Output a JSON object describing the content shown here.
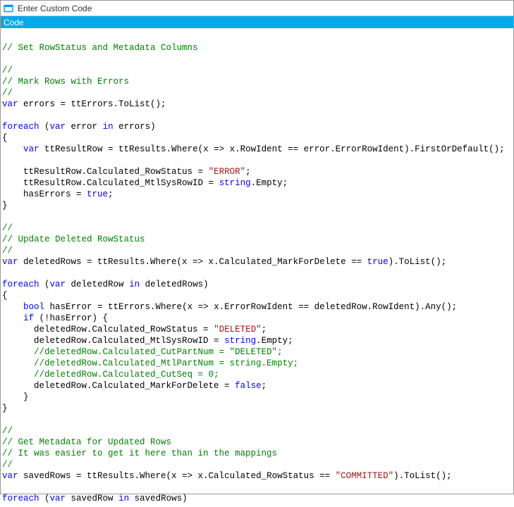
{
  "window": {
    "title": "Enter Custom Code"
  },
  "tab": {
    "label": "Code"
  },
  "code": {
    "l1": "// Set RowStatus and Metadata Columns",
    "l2": "",
    "l3": "//",
    "l4": "// Mark Rows with Errors",
    "l5": "//",
    "l6a": "var",
    "l6b": " errors = ttErrors.ToList();",
    "l7": "",
    "l8a": "foreach",
    "l8b": " (",
    "l8c": "var",
    "l8d": " error ",
    "l8e": "in",
    "l8f": " errors)",
    "l9": "{",
    "l10a": "    ",
    "l10b": "var",
    "l10c": " ttResultRow = ttResults.Where(x => x.RowIdent == error.ErrorRowIdent).FirstOrDefault();",
    "l11": "",
    "l12a": "    ttResultRow.Calculated_RowStatus = ",
    "l12b": "\"ERROR\"",
    "l12c": ";",
    "l13a": "    ttResultRow.Calculated_MtlSysRowID = ",
    "l13b": "string",
    "l13c": ".Empty;",
    "l14a": "    hasErrors = ",
    "l14b": "true",
    "l14c": ";",
    "l15": "}",
    "l16": "",
    "l17": "//",
    "l18": "// Update Deleted RowStatus",
    "l19": "//",
    "l20a": "var",
    "l20b": " deletedRows = ttResults.Where(x => x.Calculated_MarkForDelete == ",
    "l20c": "true",
    "l20d": ").ToList();",
    "l21": "",
    "l22a": "foreach",
    "l22b": " (",
    "l22c": "var",
    "l22d": " deletedRow ",
    "l22e": "in",
    "l22f": " deletedRows)",
    "l23": "{",
    "l24a": "    ",
    "l24b": "bool",
    "l24c": " hasError = ttErrors.Where(x => x.ErrorRowIdent == deletedRow.RowIdent).Any();",
    "l25a": "    ",
    "l25b": "if",
    "l25c": " (!hasError) {",
    "l26a": "      deletedRow.Calculated_RowStatus = ",
    "l26b": "\"DELETED\"",
    "l26c": ";",
    "l27a": "      deletedRow.Calculated_MtlSysRowID = ",
    "l27b": "string",
    "l27c": ".Empty;",
    "l28": "      //deletedRow.Calculated_CutPartNum = \"DELETED\";",
    "l29": "      //deletedRow.Calculated_MtlPartNum = string.Empty;",
    "l30": "      //deletedRow.Calculated_CutSeq = 0;",
    "l31a": "      deletedRow.Calculated_MarkForDelete = ",
    "l31b": "false",
    "l31c": ";",
    "l32": "    }",
    "l33": "}",
    "l34": "",
    "l35": "//",
    "l36": "// Get Metadata for Updated Rows",
    "l37": "// It was easier to get it here than in the mappings",
    "l38": "//",
    "l39a": "var",
    "l39b": " savedRows = ttResults.Where(x => x.Calculated_RowStatus == ",
    "l39c": "\"COMMITTED\"",
    "l39d": ").ToList();",
    "l40": "",
    "l41a": "foreach",
    "l41b": " (",
    "l41c": "var",
    "l41d": " savedRow ",
    "l41e": "in",
    "l41f": " savedRows)"
  }
}
